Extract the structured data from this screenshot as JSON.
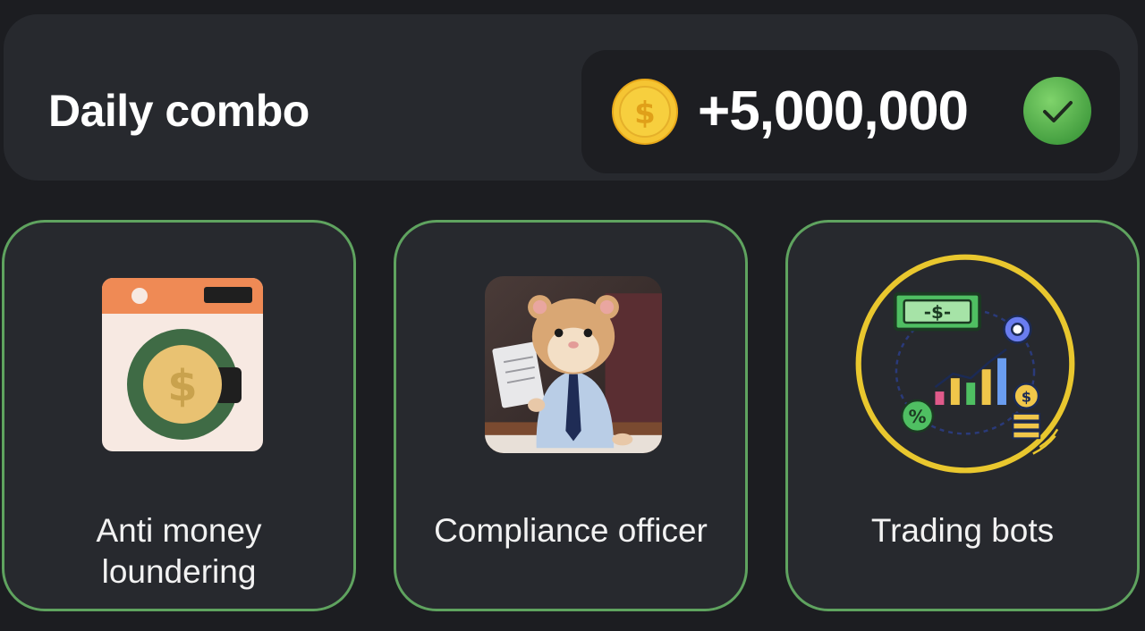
{
  "header": {
    "title": "Daily combo",
    "reward": {
      "icon": "dollar-coin-icon",
      "value": "+5,000,000",
      "status_icon": "check-circle-icon",
      "completed": true
    }
  },
  "cards": [
    {
      "label_line1": "Anti money",
      "label_line2": "loundering",
      "icon": "washing-machine-dollar-icon"
    },
    {
      "label_line1": "Compliance officer",
      "label_line2": "",
      "icon": "hamster-officer-image"
    },
    {
      "label_line1": "Trading bots",
      "label_line2": "",
      "icon": "trading-bot-chart-icon"
    }
  ],
  "colors": {
    "background": "#1c1d21",
    "card": "#27292e",
    "pill": "#1d1e22",
    "card_border": "#5fa35f",
    "coin": "#f2c02e",
    "check": "#4caf50"
  }
}
